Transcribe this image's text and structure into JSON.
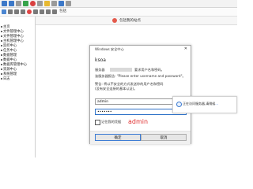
{
  "left_panel": {
    "caption": "",
    "items": [
      "主页",
      "文件管理中心",
      "文件管理中心",
      "主机管理中心",
      "监控中心",
      "任务中心",
      "数据管理",
      "数据中心",
      "数据库管理中心",
      "资源中心",
      "系统管理",
      "日志"
    ]
  },
  "tabbar": {
    "tab_label": "包括我的站点"
  },
  "favbar": {
    "label": "包括"
  },
  "dialog": {
    "title": "Windows 安全中心",
    "app_name": "ksoa",
    "server_label": "服务器",
    "server_rest": "要求用户名和密码。",
    "warning_line1": "该服务器报告: \"Please enter username and password\"。",
    "warning_line2": "警告: 将以不安全的方式发送你的用户名和密码",
    "warning_line3": "(没有安全连接的基本认证)。",
    "username_value": "admin",
    "password_value": "•••••••",
    "remember_label": "记住我的凭据",
    "annotation": "admin",
    "ok_label": "确定",
    "cancel_label": "取消"
  },
  "toast": {
    "text": "正在访问服务器,请稍候",
    "link": "..."
  },
  "colors": {
    "accent": "#2f72c8",
    "annotation_red": "#e03030",
    "toolbar_bg": "#f3f3f3"
  }
}
